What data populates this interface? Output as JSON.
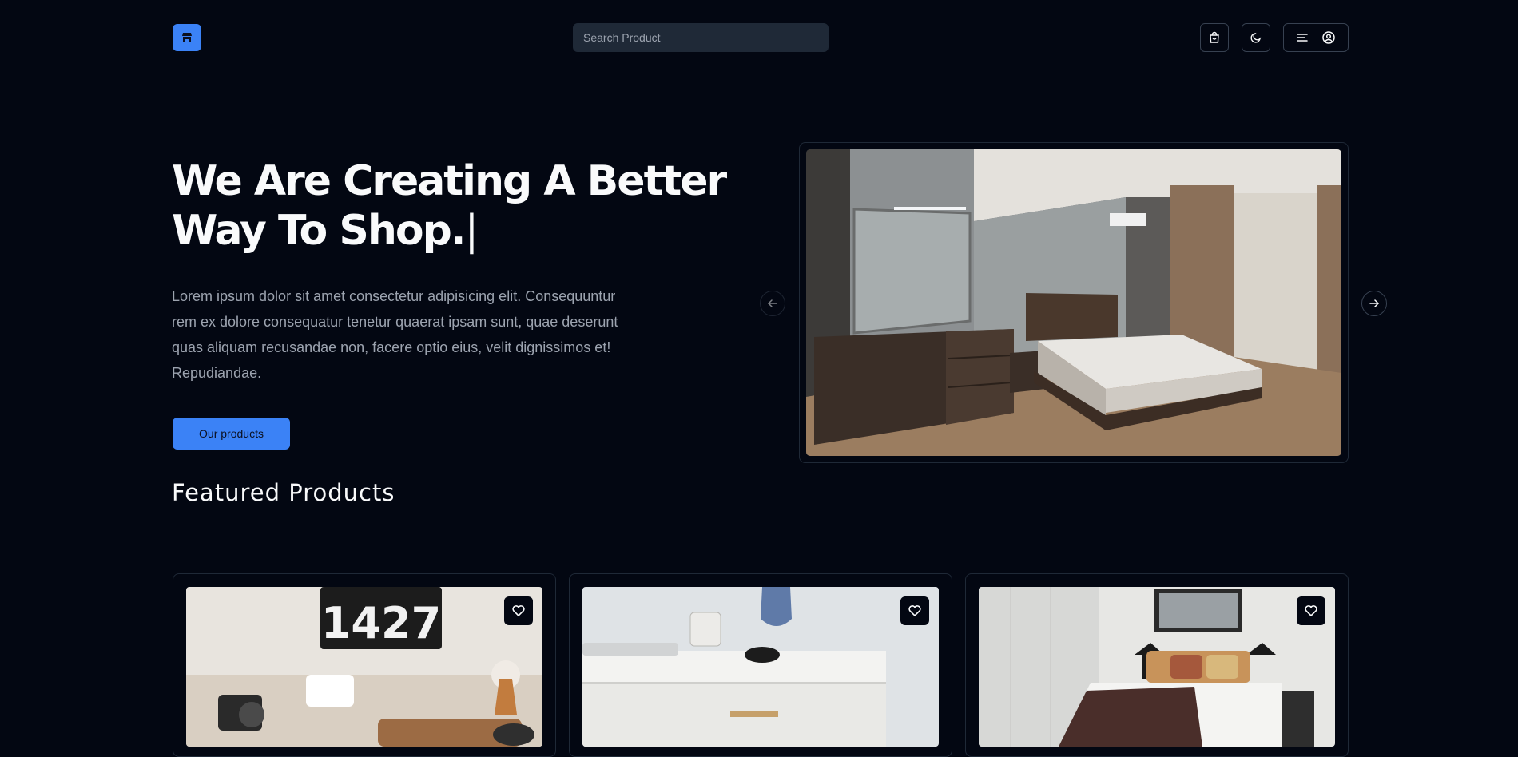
{
  "header": {
    "logo_icon": "store-icon",
    "search": {
      "placeholder": "Search Product",
      "value": ""
    },
    "cart_icon": "shopping-bag-icon",
    "theme_icon": "moon-icon",
    "menu_icon": "menu-icon",
    "user_icon": "user-circle-icon"
  },
  "hero": {
    "title": "We Are Creating A Better Way To Shop.",
    "cursor": "|",
    "description": "Lorem ipsum dolor sit amet consectetur adipisicing elit. Consequuntur rem ex dolore consequatur tenetur quaerat ipsam sunt, quae deserunt quas aliquam recusandae non, facere optio eius, velit dignissimos et! Repudiandae.",
    "cta_label": "Our products",
    "carousel": {
      "prev_icon": "arrow-left-icon",
      "next_icon": "arrow-right-icon",
      "image": "bedroom-photo"
    }
  },
  "featured": {
    "title": "Featured Products",
    "products": [
      {
        "image": "desk-clock-camera-photo",
        "favorite_icon": "heart-icon"
      },
      {
        "image": "white-dresser-photo",
        "favorite_icon": "heart-icon"
      },
      {
        "image": "hotel-bedroom-photo",
        "favorite_icon": "heart-icon"
      }
    ]
  },
  "colors": {
    "background": "#030712",
    "accent": "#3b82f6",
    "border": "#1f2937",
    "muted_text": "#9ca3af"
  }
}
